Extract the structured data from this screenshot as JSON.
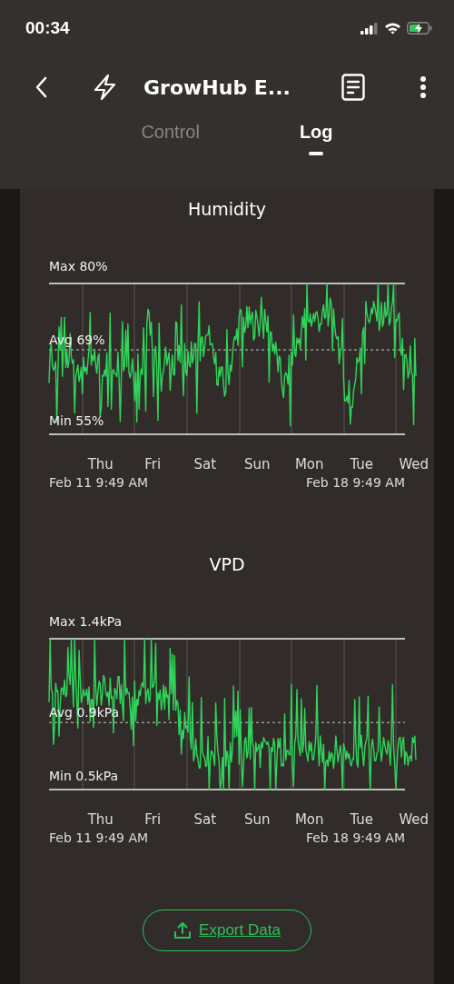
{
  "status_bar": {
    "time": "00:34"
  },
  "nav": {
    "title": "GrowHub E..."
  },
  "tabs": [
    {
      "label": "Control",
      "selected": false
    },
    {
      "label": "Log",
      "selected": true
    }
  ],
  "charts": [
    {
      "title": "Humidity",
      "max_label": "Max 80%",
      "avg_label": "Avg 69%",
      "min_label": "Min 55%",
      "days": [
        "Thu",
        "Fri",
        "Sat",
        "Sun",
        "Mon",
        "Tue",
        "Wed"
      ],
      "start_date": "Feb 11 9:49 AM",
      "end_date": "Feb 18 9:49 AM"
    },
    {
      "title": "VPD",
      "max_label": "Max 1.4kPa",
      "avg_label": "Avg 0.9kPa",
      "min_label": "Min 0.5kPa",
      "days": [
        "Thu",
        "Fri",
        "Sat",
        "Sun",
        "Mon",
        "Tue",
        "Wed"
      ],
      "start_date": "Feb 11 9:49 AM",
      "end_date": "Feb 18 9:49 AM"
    }
  ],
  "export_button": {
    "label": "Export Data"
  }
}
